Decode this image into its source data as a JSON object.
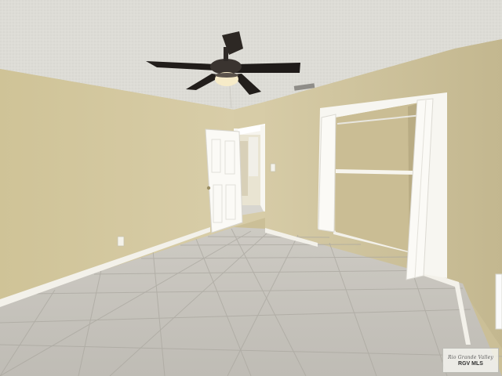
{
  "watermark": {
    "line1": "Rio Grande Valley",
    "line2": "RGV MLS"
  },
  "colors": {
    "wall": "#d3c7a0",
    "ceiling": "#dcdbd5",
    "floor": "#c9c7c1",
    "trim": "#f2f0e8",
    "fan": "#2a2522"
  }
}
